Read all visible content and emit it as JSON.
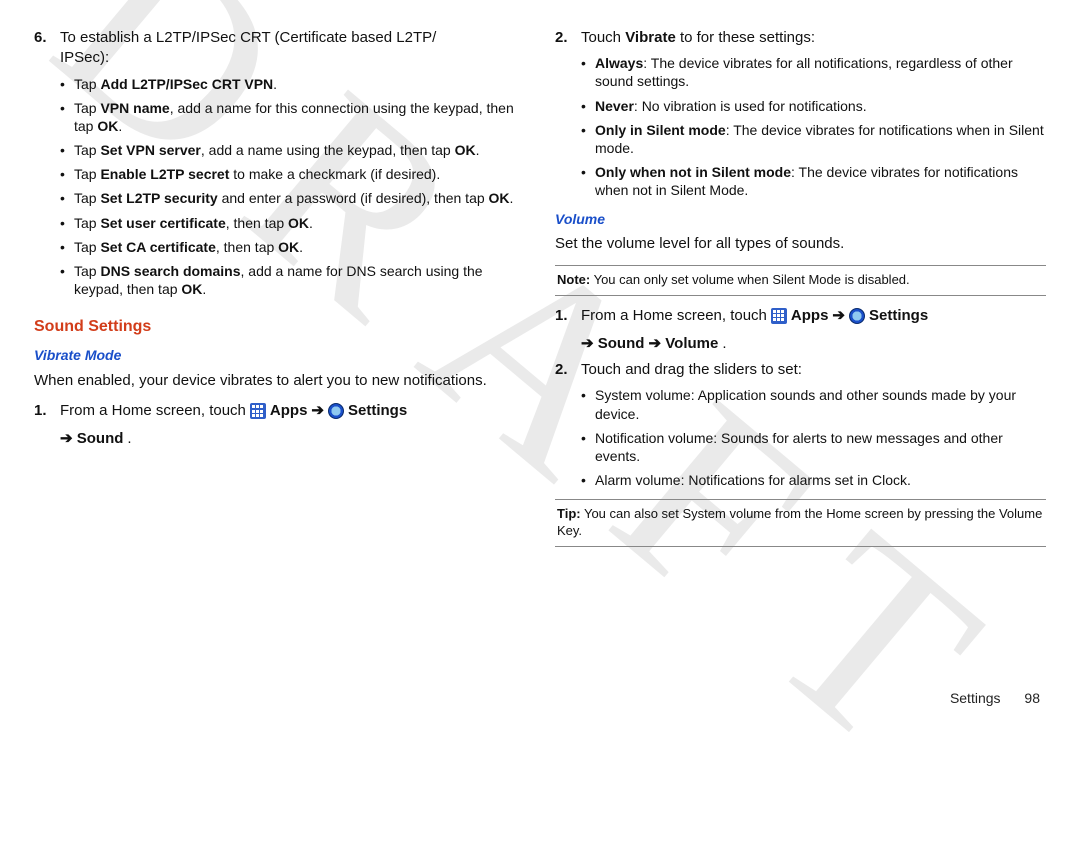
{
  "watermark": "DRAFT",
  "left": {
    "step6_num": "6.",
    "step6_text_a": "To establish a L2TP/IPSec CRT (Certificate based L2TP/",
    "step6_text_b": "IPSec):",
    "b1_pre": "Tap ",
    "b1_bold": "Add L2TP/IPSec CRT VPN",
    "b1_post": ".",
    "b2_pre": "Tap ",
    "b2_bold": "VPN name",
    "b2_post": ", add a name for this connection using the keypad, then tap ",
    "b2_bold2": "OK",
    "b2_post2": ".",
    "b3_pre": "Tap ",
    "b3_bold": "Set VPN server",
    "b3_post": ", add a name using the keypad, then tap ",
    "b3_bold2": "OK",
    "b3_post2": ".",
    "b4_pre": "Tap ",
    "b4_bold": "Enable L2TP secret",
    "b4_post": " to make a checkmark (if desired).",
    "b5_pre": "Tap ",
    "b5_bold": "Set L2TP security",
    "b5_post": " and enter a password (if desired), then tap ",
    "b5_bold2": "OK",
    "b5_post2": ".",
    "b6_pre": "Tap ",
    "b6_bold": "Set user certificate",
    "b6_post": ", then tap ",
    "b6_bold2": "OK",
    "b6_post2": ".",
    "b7_pre": "Tap ",
    "b7_bold": "Set CA certificate",
    "b7_post": ", then tap ",
    "b7_bold2": "OK",
    "b7_post2": ".",
    "b8_pre": "Tap ",
    "b8_bold": "DNS search domains",
    "b8_post": ", add a name for DNS search using the keypad, then tap ",
    "b8_bold2": "OK",
    "b8_post2": ".",
    "section": "Sound Settings",
    "sub": "Vibrate Mode",
    "intro": "When enabled, your device vibrates to alert you to new notifications.",
    "s1_num": "1.",
    "s1_a": "From a Home screen, touch ",
    "s1_apps": "Apps",
    "s1_arrow": "➔",
    "s1_settings": "Settings",
    "s1_b": " ➔ Sound",
    "s1_c": "."
  },
  "right": {
    "s2_num": "2.",
    "s2_a": "Touch ",
    "s2_bold": "Vibrate",
    "s2_b": " to for these settings:",
    "rb1_bold": "Always",
    "rb1": ": The device vibrates for all notifications, regardless of other sound settings.",
    "rb2_bold": "Never",
    "rb2": ": No vibration is used for notifications.",
    "rb3_bold": "Only in Silent mode",
    "rb3": ": The device vibrates for notifications when in Silent mode.",
    "rb4_bold": "Only when not in Silent mode",
    "rb4": ": The device vibrates for notifications when not in Silent Mode.",
    "sub": "Volume",
    "intro": "Set the volume level for all types of sounds.",
    "note_label": "Note:",
    "note": " You can only set volume when Silent Mode is disabled.",
    "v1_num": "1.",
    "v1_a": "From a Home screen, touch ",
    "v1_apps": "Apps",
    "v1_arrow": "➔",
    "v1_settings": "Settings",
    "v1_cont": "➔ Sound ➔ Volume",
    "v1_dot": ".",
    "v2_num": "2.",
    "v2": "Touch and drag the sliders to set:",
    "vb1": "System volume: Application sounds and other sounds made by your device.",
    "vb2": "Notification volume: Sounds for alerts to new messages and other events.",
    "vb3": "Alarm volume: Notifications for alarms set in Clock.",
    "tip_label": "Tip:",
    "tip": " You can also set System volume from the Home screen by pressing the Volume Key."
  },
  "footer": {
    "section": "Settings",
    "page": "98"
  }
}
